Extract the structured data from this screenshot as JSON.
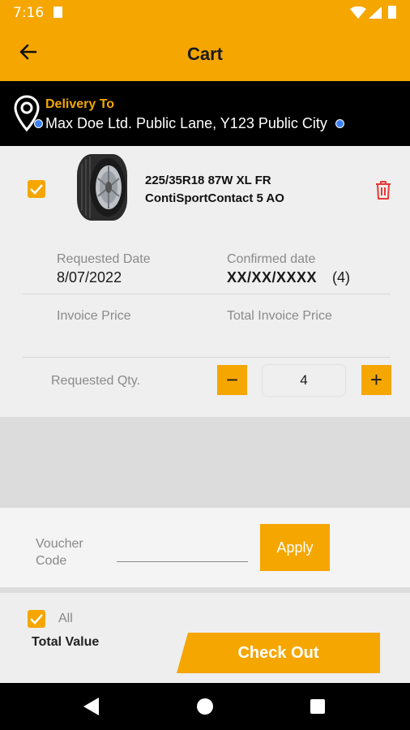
{
  "status_bar": {
    "time": "7:16"
  },
  "app_bar": {
    "title": "Cart"
  },
  "delivery": {
    "label": "Delivery To",
    "address": "Max Doe Ltd. Public Lane, Y123 Public City"
  },
  "item": {
    "selected": true,
    "product_line1": "225/35R18 87W XL FR",
    "product_line2": "ContiSportContact 5 AO",
    "requested_date_label": "Requested Date",
    "requested_date_value": "8/07/2022",
    "confirmed_date_label": "Confirmed date",
    "confirmed_date_value": "XX/XX/XXXX",
    "confirmed_count": "(4)",
    "invoice_price_label": "Invoice Price",
    "total_invoice_price_label": "Total Invoice Price",
    "requested_qty_label": "Requested Qty.",
    "quantity": "4",
    "decrement_symbol": "−",
    "increment_symbol": "+"
  },
  "voucher": {
    "label_line1": "Voucher",
    "label_line2": "Code",
    "apply_label": "Apply"
  },
  "summary": {
    "all_label": "All",
    "total_value_label": "Total Value",
    "checkout_label": "Check Out"
  },
  "colors": {
    "accent": "#F5A600",
    "danger": "#E53935",
    "dark": "#000000"
  },
  "icons": [
    "back-arrow-icon",
    "location-pin-icon",
    "tyre-image",
    "trash-icon",
    "check-icon",
    "nav-back-icon",
    "nav-home-icon",
    "nav-recents-icon"
  ]
}
